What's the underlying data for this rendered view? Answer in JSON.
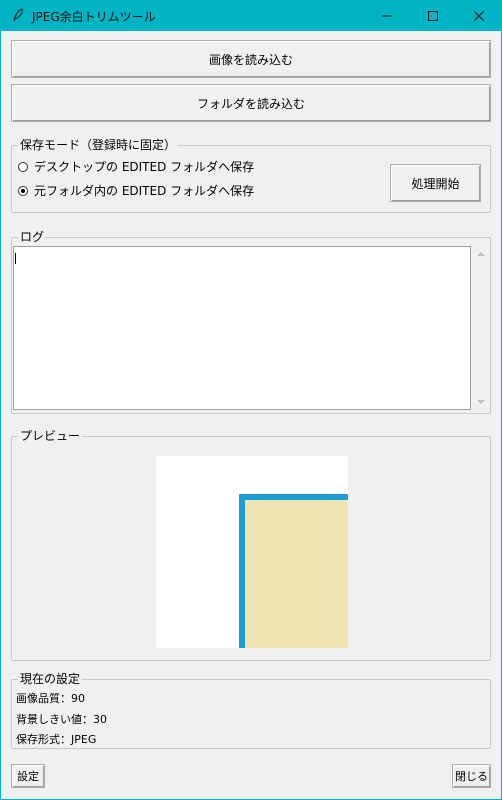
{
  "window": {
    "title": "JPEG余白トリムツール"
  },
  "buttons": {
    "load_image": "画像を読み込む",
    "load_folder": "フォルダを読み込む",
    "process": "処理開始",
    "settings": "設定",
    "close": "閉じる"
  },
  "save_mode": {
    "legend": "保存モード（登録時に固定）",
    "options": [
      {
        "label": "デスクトップの EDITED フォルダへ保存",
        "selected": false
      },
      {
        "label": "元フォルダ内の EDITED フォルダへ保存",
        "selected": true
      }
    ]
  },
  "log": {
    "legend": "ログ",
    "content": ""
  },
  "preview": {
    "legend": "プレビュー",
    "colors": {
      "background": "#ffffff",
      "border": "#1e9ed6",
      "fill": "#efe3b0"
    }
  },
  "current_settings": {
    "legend": "現在の設定",
    "quality": "画像品質：90",
    "threshold": "背景しきい値：30",
    "format": "保存形式：JPEG"
  },
  "colors": {
    "titlebar": "#00b4c4",
    "window_bg": "#f0f0f0"
  },
  "icons": {
    "app": "feather-icon",
    "minimize": "minimize-icon",
    "maximize": "maximize-icon",
    "close": "close-icon"
  }
}
